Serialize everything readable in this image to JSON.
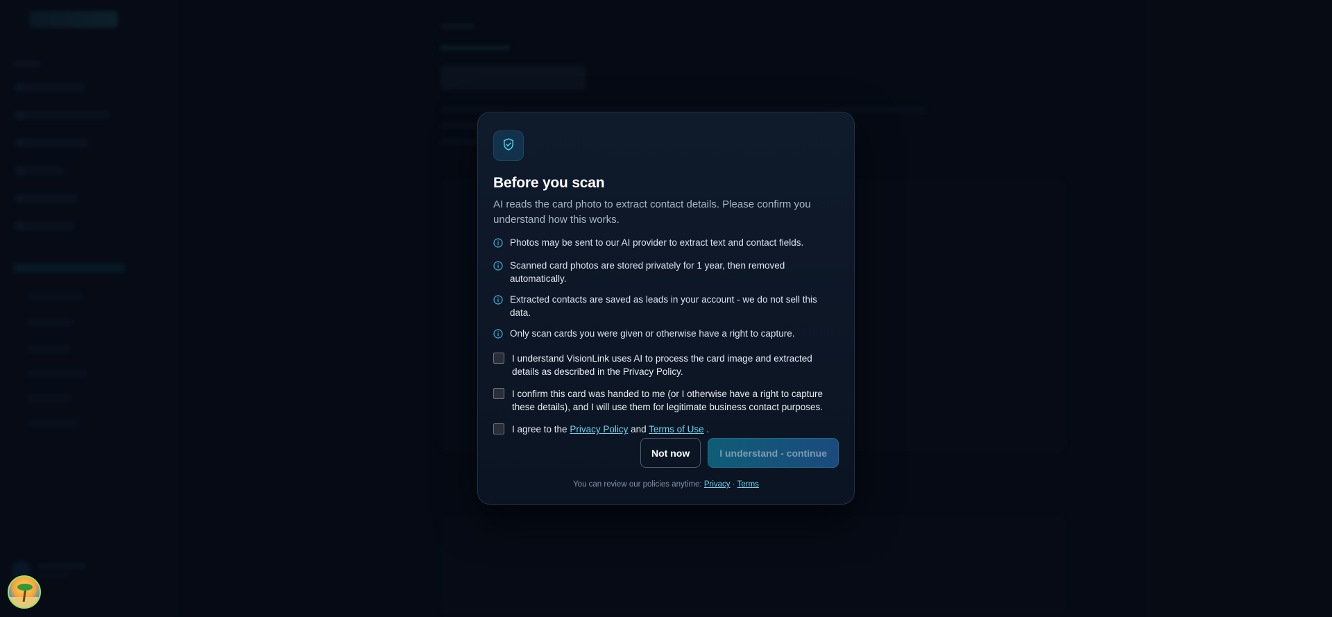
{
  "modal": {
    "title": "Before you scan",
    "subtitle": "AI reads the card photo to extract contact details. Please confirm you understand how this works.",
    "facts": [
      "Photos may be sent to our AI provider to extract text and contact fields.",
      "Scanned card photos are stored privately for 1 year, then removed automatically.",
      "Extracted contacts are saved as leads in your account - we do not sell this data.",
      "Only scan cards you were given or otherwise have a right to capture."
    ],
    "checks": {
      "ai_consent": "I understand VisionLink uses AI to process the card image and extracted details as described in the Privacy Policy.",
      "rights_confirm": "I confirm this card was handed to me (or I otherwise have a right to capture these details), and I will use them for legitimate business contact purposes.",
      "agree_prefix": "I agree to the",
      "privacy_link": "Privacy Policy",
      "and_text": "and",
      "terms_link": "Terms of Use",
      "agree_suffix": "."
    },
    "buttons": {
      "not_now": "Not now",
      "continue": "I understand - continue"
    },
    "footer": {
      "text": "You can review our policies anytime:",
      "privacy": "Privacy",
      "separator": "·",
      "terms": "Terms"
    }
  },
  "colors": {
    "accent": "#6fd3ee",
    "primary_button_start": "#0e5d76",
    "primary_button_end": "#1b4a7e",
    "modal_bg": "#0f1a2b",
    "page_bg": "#070d17"
  },
  "icons": {
    "modal_header": "shield-check-icon",
    "fact_bullet": "info-icon"
  }
}
